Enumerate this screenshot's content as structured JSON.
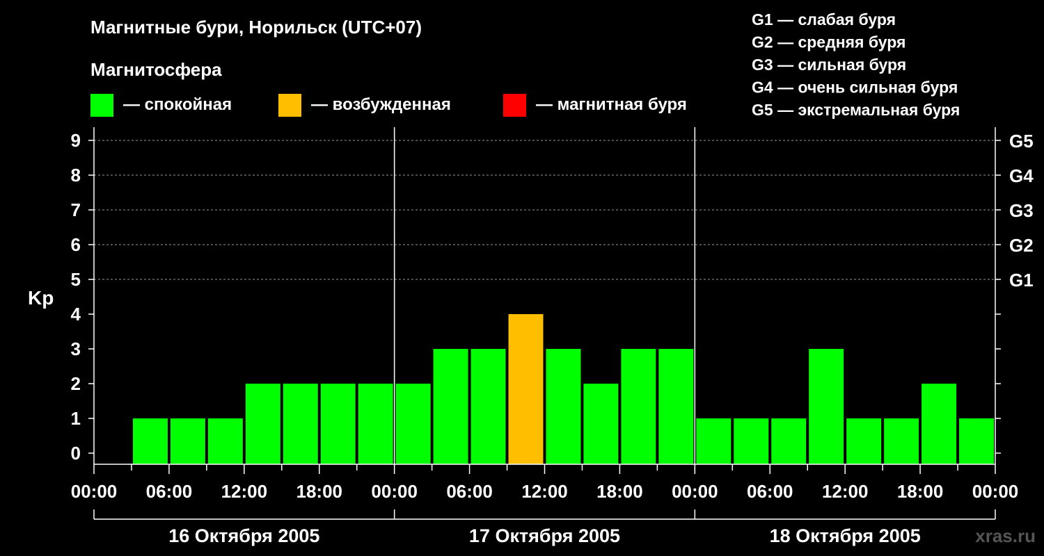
{
  "chart_data": {
    "type": "bar",
    "title": "Магнитные бури, Норильск (UTC+07)",
    "subtitle": "Магнитосфера",
    "ylabel": "Kp",
    "ylim": [
      0,
      9
    ],
    "y_ticks": [
      "0",
      "1",
      "2",
      "3",
      "4",
      "5",
      "6",
      "7",
      "8",
      "9"
    ],
    "right_ticks": [
      {
        "kp": 5,
        "label": "G1"
      },
      {
        "kp": 6,
        "label": "G2"
      },
      {
        "kp": 7,
        "label": "G3"
      },
      {
        "kp": 8,
        "label": "G4"
      },
      {
        "kp": 9,
        "label": "G5"
      }
    ],
    "legend": [
      {
        "label": "— спокойная",
        "color": "#00ff00"
      },
      {
        "label": "— возбужденная",
        "color": "#ffbf00"
      },
      {
        "label": "— магнитная буря",
        "color": "#ff0000"
      }
    ],
    "scale_legend": [
      "G1 — слабая буря",
      "G2 — средняя буря",
      "G3 — сильная буря",
      "G4 — очень сильная буря",
      "G5 — экстремальная буря"
    ],
    "x_tick_labels": [
      "00:00",
      "06:00",
      "12:00",
      "18:00",
      "00:00",
      "06:00",
      "12:00",
      "18:00",
      "00:00",
      "06:00",
      "12:00",
      "18:00",
      "00:00"
    ],
    "days": [
      "16 Октября 2005",
      "17 Октября 2005",
      "18 Октября 2005"
    ],
    "grid": "dashed, Kp 5–9",
    "values": [
      0,
      1,
      1,
      1,
      2,
      2,
      2,
      2,
      2,
      3,
      3,
      4,
      3,
      2,
      3,
      3,
      1,
      1,
      1,
      3,
      1,
      1,
      2,
      1
    ],
    "bar_colors": [
      "#00ff00",
      "#00ff00",
      "#00ff00",
      "#00ff00",
      "#00ff00",
      "#00ff00",
      "#00ff00",
      "#00ff00",
      "#00ff00",
      "#00ff00",
      "#00ff00",
      "#ffbf00",
      "#00ff00",
      "#00ff00",
      "#00ff00",
      "#00ff00",
      "#00ff00",
      "#00ff00",
      "#00ff00",
      "#00ff00",
      "#00ff00",
      "#00ff00",
      "#00ff00",
      "#00ff00"
    ]
  },
  "watermark": "xras.ru"
}
